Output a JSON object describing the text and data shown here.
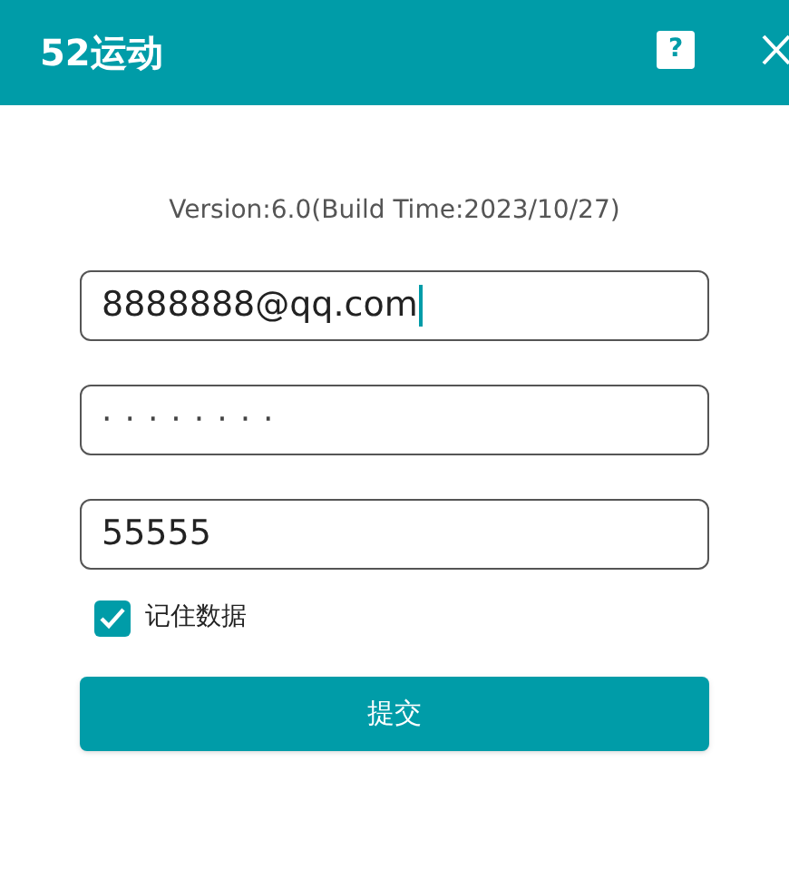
{
  "title_bar": {
    "title": "52运动",
    "help_label": "?"
  },
  "version": "Version:6.0(Build Time:2023/10/27)",
  "fields": [
    {
      "kind": "text",
      "value": "8888888@qq.com",
      "focused": true
    },
    {
      "kind": "password",
      "value": "········",
      "focused": false
    },
    {
      "kind": "text",
      "value": "55555",
      "focused": false
    }
  ],
  "remember": {
    "label": "记住数据",
    "checked": true
  },
  "submit_button": "提交"
}
